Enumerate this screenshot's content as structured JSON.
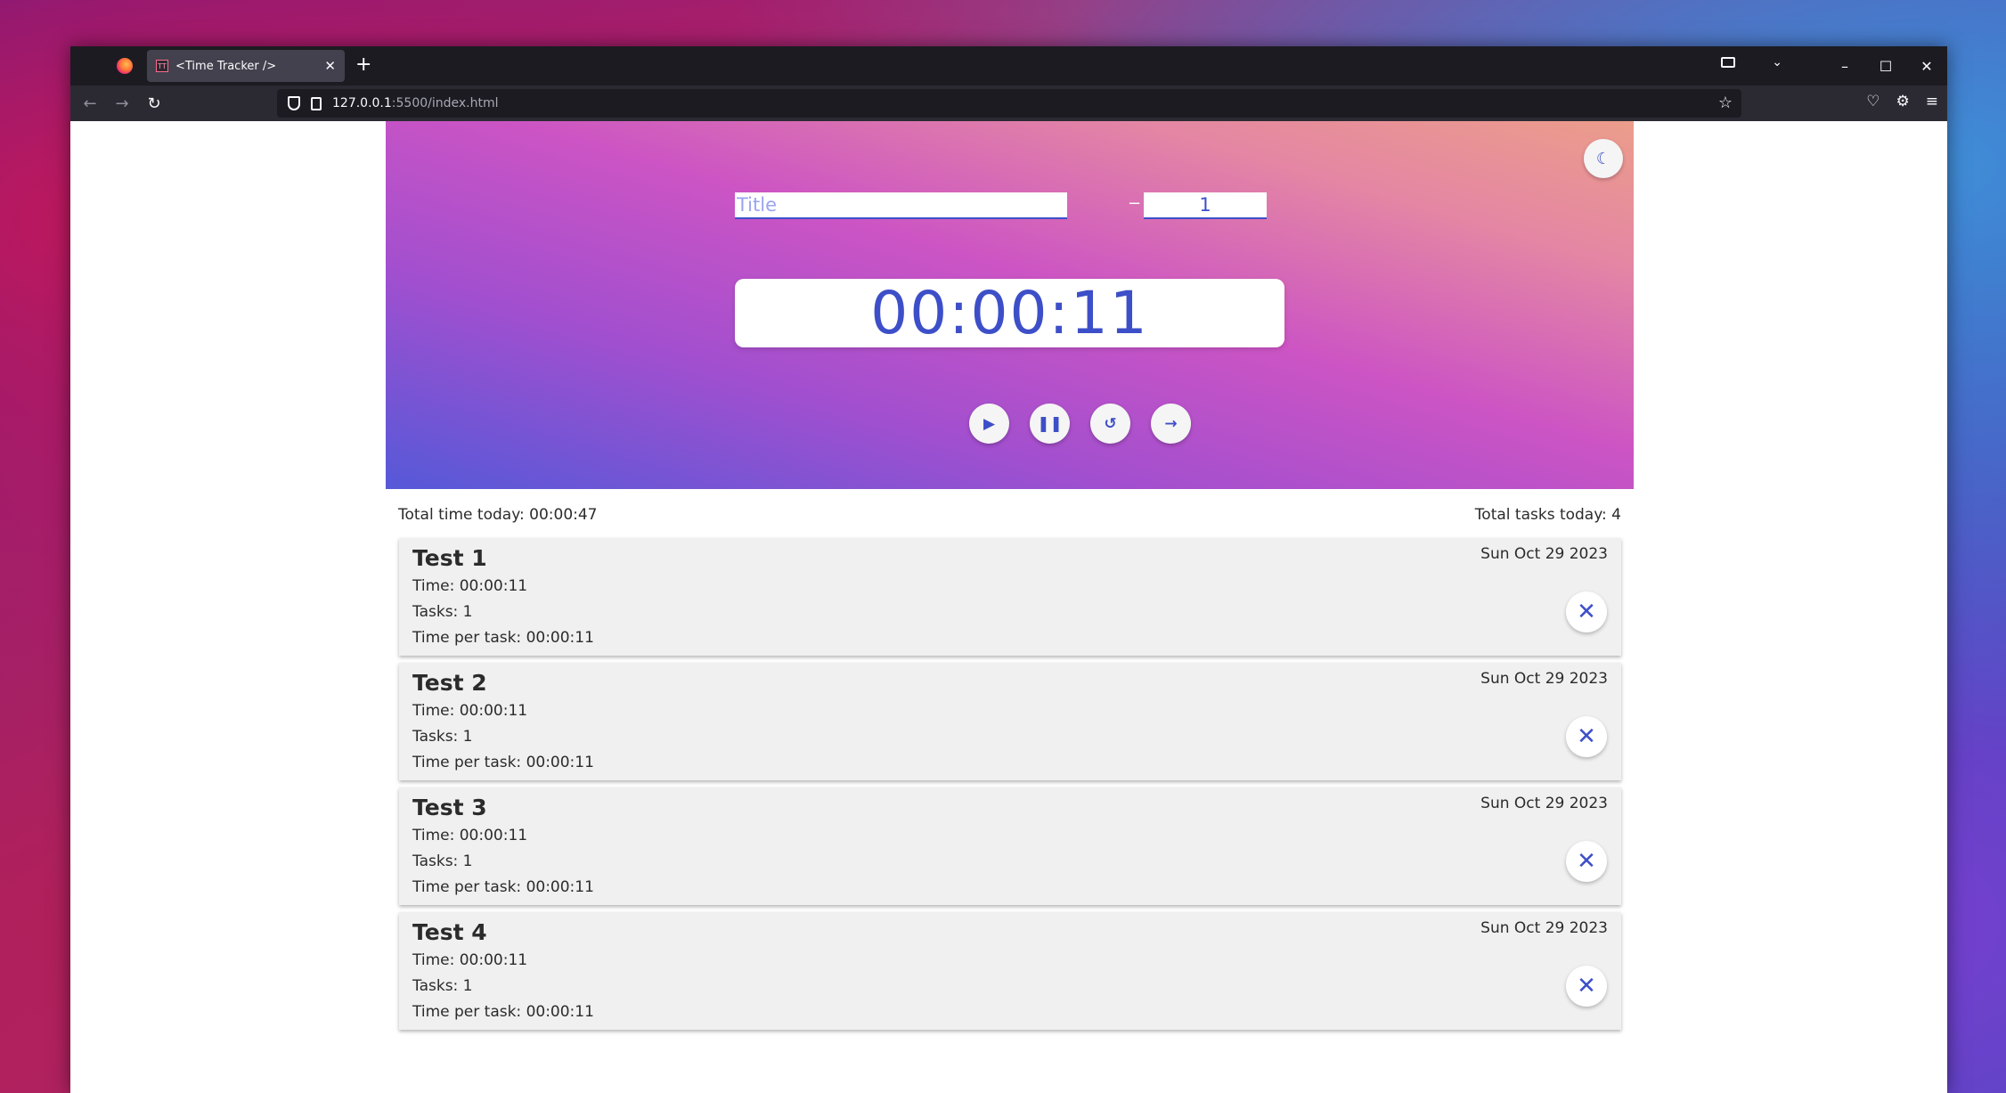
{
  "browser": {
    "tab_title": "<Time Tracker />",
    "tab_favicon_text": "TT",
    "url_host": "127.0.0.1",
    "url_path": ":5500/index.html"
  },
  "tracker": {
    "title_placeholder": "Title",
    "title_value": "",
    "task_count": "1",
    "timer": "00:00:11",
    "minus_label": "−",
    "plus_label": "+"
  },
  "summary": {
    "total_time": "Total time today: 00:00:47",
    "total_tasks": "Total tasks today: 4"
  },
  "tasks": [
    {
      "title": "Test 1",
      "date": "Sun Oct 29 2023",
      "time": "Time: 00:00:11",
      "tasks": "Tasks: 1",
      "per_task": "Time per task: 00:00:11"
    },
    {
      "title": "Test 2",
      "date": "Sun Oct 29 2023",
      "time": "Time: 00:00:11",
      "tasks": "Tasks: 1",
      "per_task": "Time per task: 00:00:11"
    },
    {
      "title": "Test 3",
      "date": "Sun Oct 29 2023",
      "time": "Time: 00:00:11",
      "tasks": "Tasks: 1",
      "per_task": "Time per task: 00:00:11"
    },
    {
      "title": "Test 4",
      "date": "Sun Oct 29 2023",
      "time": "Time: 00:00:11",
      "tasks": "Tasks: 1",
      "per_task": "Time per task: 00:00:11"
    }
  ],
  "colors": {
    "accent": "#3d4fc8",
    "card_bg": "#f0f0f0"
  }
}
